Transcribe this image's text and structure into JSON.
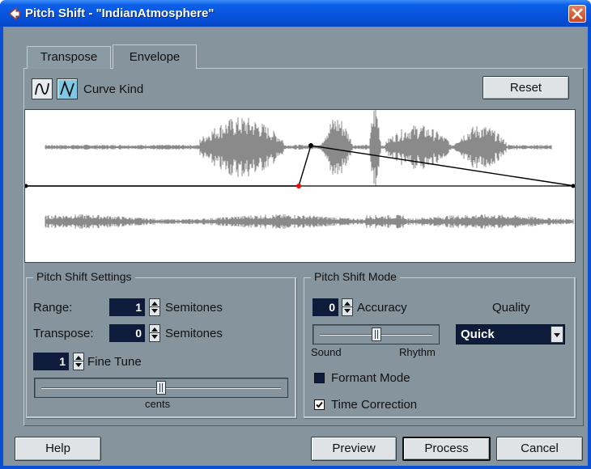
{
  "window": {
    "title": "Pitch Shift - \"IndianAtmosphere\"",
    "titlebar_color": "#0c5fe8",
    "client_color": "#85949d"
  },
  "tabs": [
    {
      "label": "Transpose",
      "active": false
    },
    {
      "label": "Envelope",
      "active": true
    }
  ],
  "envelope": {
    "curve_kind_label": "Curve Kind",
    "curve_kinds": [
      "spline-curve-icon",
      "linear-curve-icon"
    ],
    "reset_label": "Reset",
    "envelope_line_color": "#000000",
    "selected_point_color": "#ff0000"
  },
  "pitch_shift_settings": {
    "title": "Pitch Shift Settings",
    "range_label": "Range:",
    "range_value": "1",
    "range_unit": "Semitones",
    "transpose_label": "Transpose:",
    "transpose_value": "0",
    "transpose_unit": "Semitones",
    "fine_tune_value": "1",
    "fine_tune_label": "Fine Tune",
    "cents_label": "cents",
    "fine_tune_slider_position": 0.5
  },
  "pitch_shift_mode": {
    "title": "Pitch Shift Mode",
    "accuracy_value": "0",
    "accuracy_label": "Accuracy",
    "slider_left_label": "Sound",
    "slider_right_label": "Rhythm",
    "accuracy_slider_position": 0.5,
    "quality_label": "Quality",
    "quality_value": "Quick",
    "formant_mode_label": "Formant Mode",
    "formant_mode_checked": false,
    "time_correction_label": "Time Correction",
    "time_correction_checked": true
  },
  "footer": {
    "help_label": "Help",
    "preview_label": "Preview",
    "process_label": "Process",
    "cancel_label": "Cancel"
  }
}
